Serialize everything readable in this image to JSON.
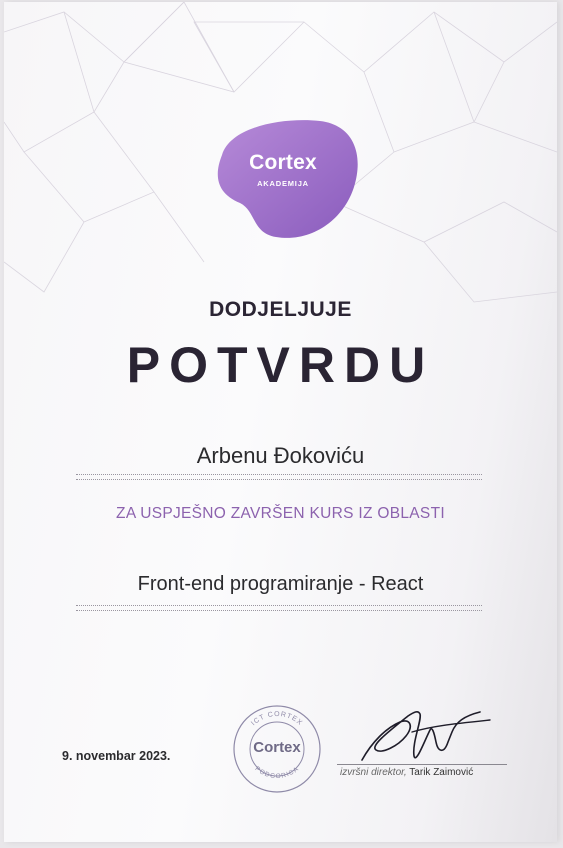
{
  "logo": {
    "brand": "Cortex",
    "subtitle": "AKADEMIJA",
    "color": "#9a6cc6"
  },
  "heading": {
    "awards": "DODJELJUJE",
    "title": "POTVRDU"
  },
  "recipient": "Arbenu Đokoviću",
  "subtitle": "ZA USPJEŠNO ZAVRŠEN KURS IZ OBLASTI",
  "course": "Front-end programiranje - React",
  "date": "9. novembar 2023.",
  "stamp": {
    "brand": "Cortex",
    "top_text": "ICT CORTEX",
    "bottom_text": "PODGORICA"
  },
  "signatory": {
    "role": "izvršni direktor,",
    "name": "Tarik Zaimović"
  },
  "colors": {
    "accent": "#8c62ae",
    "text": "#2a2433"
  }
}
